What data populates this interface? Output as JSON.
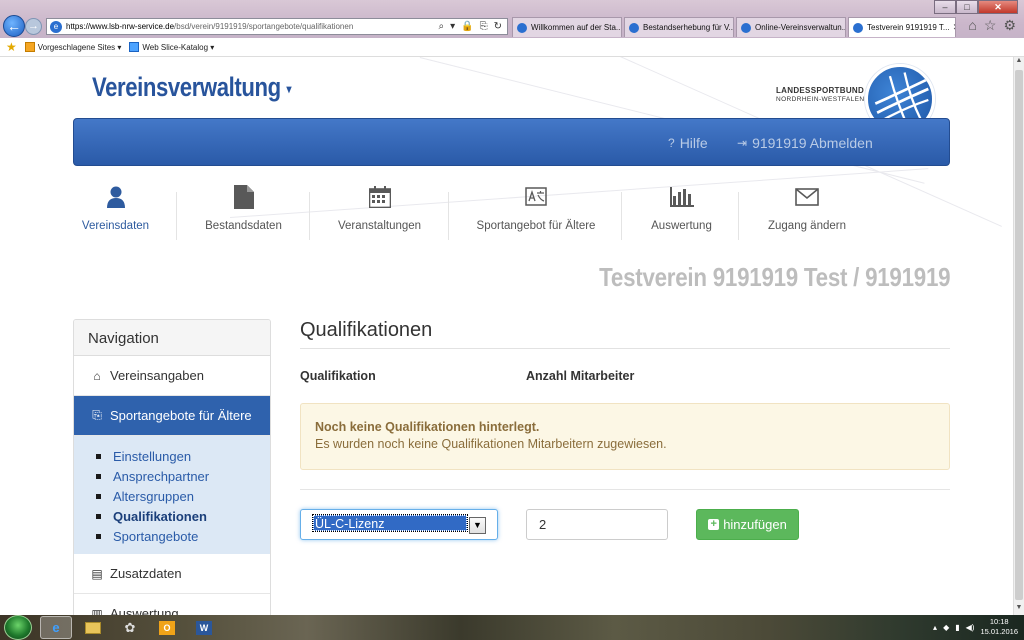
{
  "browser": {
    "url_host": "https://www.lsb-nrw-service.de",
    "url_path": "/bsd/verein/9191919/sportangebote/qualifikationen",
    "tabs": [
      {
        "label": "Willkommen auf der Sta...",
        "active": false
      },
      {
        "label": "Bestandserhebung für V...",
        "active": false
      },
      {
        "label": "Online-Vereinsverwaltun...",
        "active": false
      },
      {
        "label": "Testverein 9191919 T...",
        "active": true
      }
    ],
    "favorites": [
      "Vorgeschlagene Sites ▾",
      "Web Slice-Katalog ▾"
    ]
  },
  "header": {
    "brand": "Vereinsverwaltung",
    "federation_line1": "LANDESSPORTBUND",
    "federation_line2": "NORDRHEIN-WESTFALEN",
    "help": "Hilfe",
    "logout": "9191919 Abmelden"
  },
  "mainnav": [
    {
      "label": "Vereinsdaten",
      "icon": "user-icon",
      "active": true
    },
    {
      "label": "Bestandsdaten",
      "icon": "document-icon",
      "active": false
    },
    {
      "label": "Veranstaltungen",
      "icon": "calendar-icon",
      "active": false
    },
    {
      "label": "Sportangebot für Ältere",
      "icon": "translate-icon",
      "active": false
    },
    {
      "label": "Auswertung",
      "icon": "bar-chart-icon",
      "active": false
    },
    {
      "label": "Zugang ändern",
      "icon": "envelope-icon",
      "active": false
    }
  ],
  "club_name": "Testverein 9191919 Test / 9191919",
  "sidebar": {
    "heading": "Navigation",
    "item_vereinsangaben": "Vereinsangaben",
    "item_sportangebote": "Sportangebote für Ältere",
    "subitems": [
      "Einstellungen",
      "Ansprechpartner",
      "Altersgruppen",
      "Qualifikationen",
      "Sportangebote"
    ],
    "current_subitem": "Qualifikationen",
    "item_zusatzdaten": "Zusatzdaten",
    "item_auswertung": "Auswertung"
  },
  "content": {
    "title": "Qualifikationen",
    "col_qualifikation": "Qualifikation",
    "col_anzahl": "Anzahl Mitarbeiter",
    "alert_title": "Noch keine Qualifikationen hinterlegt.",
    "alert_text": "Es wurden noch keine Qualifikationen Mitarbeitern zugewiesen.",
    "select_value": "ÜL-C-Lizenz",
    "count_value": "2",
    "add_button": "hinzufügen"
  },
  "taskbar": {
    "time": "10:18",
    "date": "15.01.2016"
  },
  "colors": {
    "brand_blue": "#28549c",
    "bar_blue": "#2f62ad",
    "success_green": "#5cb85c",
    "alert_bg": "#fcf7e5",
    "alert_text": "#8a6d3b"
  }
}
